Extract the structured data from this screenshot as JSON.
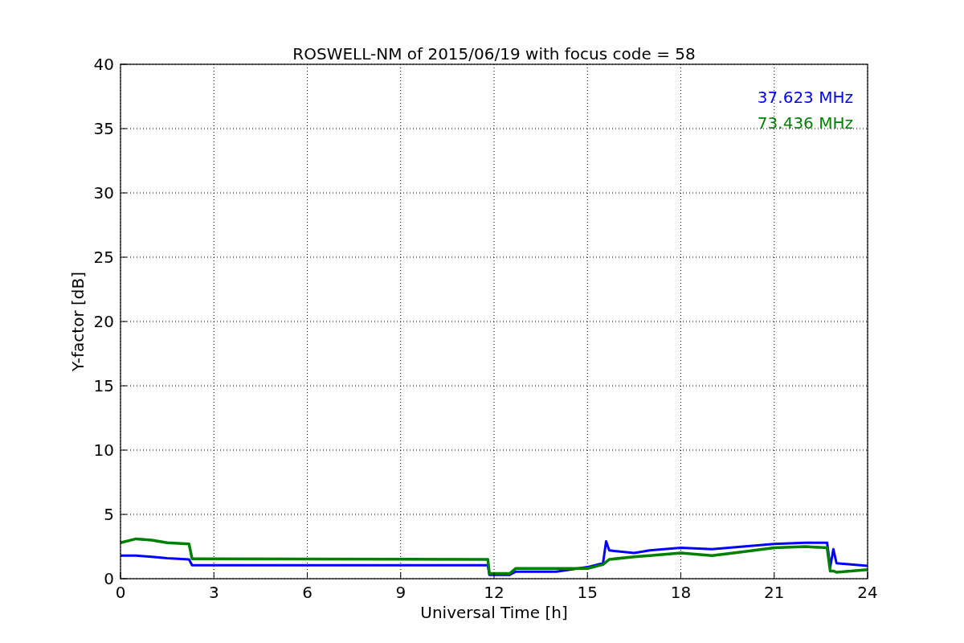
{
  "chart_data": {
    "type": "line",
    "title": "ROSWELL-NM of 2015/06/19 with focus code = 58",
    "xlabel": "Universal Time [h]",
    "ylabel": "Y-factor [dB]",
    "x": [
      0,
      0.5,
      1,
      1.5,
      2.2,
      2.3,
      11.8,
      11.85,
      12.5,
      12.7,
      14,
      15,
      15.5,
      15.6,
      15.7,
      16.5,
      17,
      18,
      19,
      20,
      21,
      22,
      22.7,
      22.8,
      22.9,
      23,
      24
    ],
    "series": [
      {
        "name": "37.623 MHz",
        "color": "#0000ff",
        "values": [
          1.8,
          1.8,
          1.7,
          1.6,
          1.5,
          1.05,
          1.05,
          0.3,
          0.3,
          0.55,
          0.55,
          0.9,
          1.2,
          2.9,
          2.2,
          2.0,
          2.2,
          2.4,
          2.3,
          2.5,
          2.7,
          2.8,
          2.8,
          0.9,
          2.3,
          1.2,
          1.0
        ]
      },
      {
        "name": "73.436 MHz",
        "color": "#008000",
        "values": [
          2.8,
          3.1,
          3.0,
          2.8,
          2.7,
          1.55,
          1.5,
          0.4,
          0.4,
          0.8,
          0.8,
          0.8,
          1.1,
          1.3,
          1.5,
          1.7,
          1.8,
          2.0,
          1.8,
          2.1,
          2.4,
          2.5,
          2.4,
          0.6,
          0.6,
          0.5,
          0.7
        ]
      }
    ],
    "xlim": [
      0,
      24
    ],
    "ylim": [
      0,
      40
    ],
    "xticks": [
      0,
      3,
      6,
      9,
      12,
      15,
      18,
      21,
      24
    ],
    "yticks": [
      0,
      5,
      10,
      15,
      20,
      25,
      30,
      35,
      40
    ],
    "grid": true
  }
}
